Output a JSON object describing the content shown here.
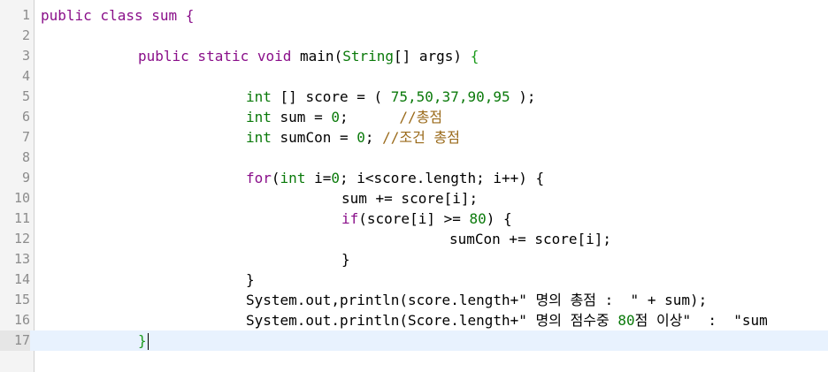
{
  "editor": {
    "current_line": 17,
    "colors": {
      "plain": "#000000",
      "keyword": "#8a0f8a",
      "type": "#0b7a0b",
      "number": "#0b7a0b",
      "comment": "#9a6a1a",
      "brace": "#1a9a1a",
      "gutter_text": "#8c8c8c",
      "current_line_bg": "#e8f2fe"
    },
    "lines": [
      {
        "n": "1",
        "indent": 0,
        "tokens": [
          {
            "t": "public class sum {",
            "c": "keyword"
          }
        ]
      },
      {
        "n": "2",
        "indent": 0,
        "tokens": []
      },
      {
        "n": "3",
        "indent": 1,
        "tokens": [
          {
            "t": "public static void ",
            "c": "keyword"
          },
          {
            "t": "main(",
            "c": "plain"
          },
          {
            "t": "String",
            "c": "type"
          },
          {
            "t": "[] args) ",
            "c": "plain"
          },
          {
            "t": "{",
            "c": "brace"
          }
        ]
      },
      {
        "n": "4",
        "indent": 0,
        "tokens": []
      },
      {
        "n": "5",
        "indent": 2,
        "tokens": [
          {
            "t": "int",
            "c": "type"
          },
          {
            "t": " [] score = ( ",
            "c": "plain"
          },
          {
            "t": "75,50,37,90,95",
            "c": "number"
          },
          {
            "t": " );",
            "c": "plain"
          }
        ]
      },
      {
        "n": "6",
        "indent": 2,
        "tokens": [
          {
            "t": "int",
            "c": "type"
          },
          {
            "t": " sum = ",
            "c": "plain"
          },
          {
            "t": "0",
            "c": "number"
          },
          {
            "t": ";      ",
            "c": "plain"
          },
          {
            "t": "//총점",
            "c": "comment"
          }
        ]
      },
      {
        "n": "7",
        "indent": 2,
        "tokens": [
          {
            "t": "int",
            "c": "type"
          },
          {
            "t": " sumCon = ",
            "c": "plain"
          },
          {
            "t": "0",
            "c": "number"
          },
          {
            "t": "; ",
            "c": "plain"
          },
          {
            "t": "//조건 총점",
            "c": "comment"
          }
        ]
      },
      {
        "n": "8",
        "indent": 0,
        "tokens": []
      },
      {
        "n": "9",
        "indent": 2,
        "tokens": [
          {
            "t": "for",
            "c": "keyword"
          },
          {
            "t": "(",
            "c": "plain"
          },
          {
            "t": "int",
            "c": "type"
          },
          {
            "t": " i=",
            "c": "plain"
          },
          {
            "t": "0",
            "c": "number"
          },
          {
            "t": "; i<score.length; i++) {",
            "c": "plain"
          }
        ]
      },
      {
        "n": "10",
        "indent": 3,
        "tokens": [
          {
            "t": "sum += score[i];",
            "c": "plain"
          }
        ]
      },
      {
        "n": "11",
        "indent": 3,
        "tokens": [
          {
            "t": "if",
            "c": "keyword"
          },
          {
            "t": "(score[i] >= ",
            "c": "plain"
          },
          {
            "t": "80",
            "c": "number"
          },
          {
            "t": ") {",
            "c": "plain"
          }
        ]
      },
      {
        "n": "12",
        "indent": 4,
        "tokens": [
          {
            "t": "sumCon += score[i];",
            "c": "plain"
          }
        ]
      },
      {
        "n": "13",
        "indent": 3,
        "tokens": [
          {
            "t": "}",
            "c": "plain"
          }
        ]
      },
      {
        "n": "14",
        "indent": 2,
        "tokens": [
          {
            "t": "}",
            "c": "plain"
          }
        ]
      },
      {
        "n": "15",
        "indent": 2,
        "tokens": [
          {
            "t": "System.out,println(score.length+\" 명의 총점 :  \" + sum);",
            "c": "plain"
          }
        ]
      },
      {
        "n": "16",
        "indent": 2,
        "tokens": [
          {
            "t": "System.out.println(Score.length+\" 명의 점수중 ",
            "c": "plain"
          },
          {
            "t": "80",
            "c": "number"
          },
          {
            "t": "점 이상\"  :  \"sum",
            "c": "plain"
          }
        ]
      },
      {
        "n": "17",
        "indent": 1,
        "tokens": [
          {
            "t": "}",
            "c": "brace"
          }
        ]
      }
    ]
  }
}
